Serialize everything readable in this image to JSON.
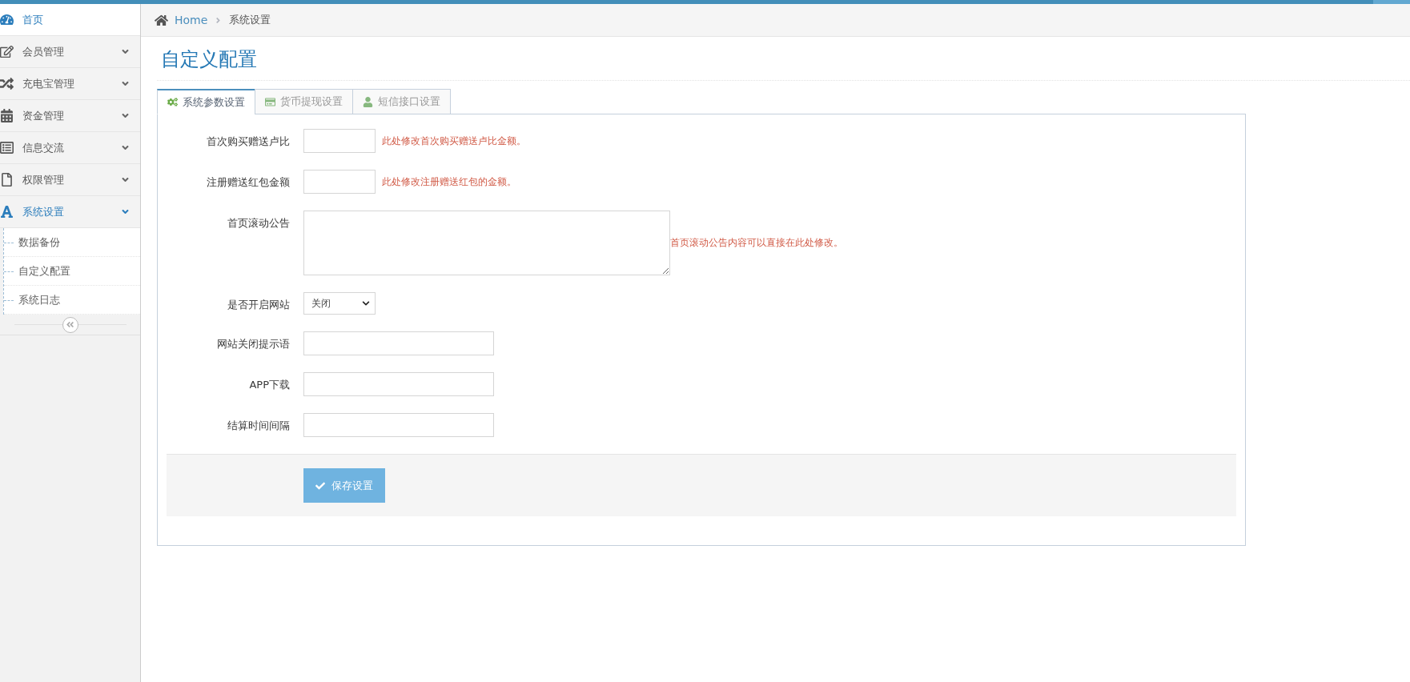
{
  "sidebar": {
    "items": [
      {
        "label": "首页",
        "selected": true,
        "expanded": false
      },
      {
        "label": "会员管理",
        "selected": false,
        "expanded": false
      },
      {
        "label": "充电宝管理",
        "selected": false,
        "expanded": false
      },
      {
        "label": "资金管理",
        "selected": false,
        "expanded": false
      },
      {
        "label": "信息交流",
        "selected": false,
        "expanded": false
      },
      {
        "label": "权限管理",
        "selected": false,
        "expanded": false
      },
      {
        "label": "系统设置",
        "selected": false,
        "expanded": true,
        "children": [
          {
            "label": "数据备份",
            "selected": false
          },
          {
            "label": "自定义配置",
            "selected": false
          },
          {
            "label": "系统日志",
            "selected": false
          }
        ]
      }
    ]
  },
  "breadcrumb": [
    {
      "label": "Home",
      "kind": "link"
    },
    {
      "label": "系统设置",
      "kind": "current"
    }
  ],
  "page_title": "自定义配置",
  "tabs": [
    {
      "label": "系统参数设置",
      "selected": true
    },
    {
      "label": "货币提现设置",
      "selected": false
    },
    {
      "label": "短信接口设置",
      "selected": false
    }
  ],
  "form": {
    "fields": [
      {
        "kind": "short",
        "label": "首次购买赠送卢比",
        "hint": "此处修改首次购买赠送卢比金额。"
      },
      {
        "kind": "short",
        "label": "注册赠送红包金额",
        "hint": "此处修改注册赠送红包的金额。"
      },
      {
        "kind": "textarea",
        "label": "首页滚动公告",
        "hint": "首页滚动公告内容可以直接在此处修改。"
      },
      {
        "kind": "select",
        "label": "是否开启网站",
        "value": "关闭"
      },
      {
        "kind": "text",
        "label": "网站关闭提示语"
      },
      {
        "kind": "text",
        "label": "APP下载"
      },
      {
        "kind": "text",
        "label": "结算时间间隔"
      }
    ],
    "submit": "保存设置"
  }
}
